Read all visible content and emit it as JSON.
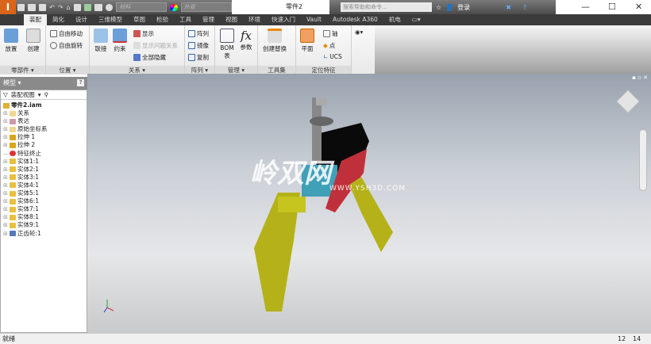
{
  "titlebar": {
    "doc_title": "零件2",
    "material_placeholder": "材料",
    "appearance_placeholder": "外观",
    "search_placeholder": "搜索帮助和命令...",
    "login": "登录"
  },
  "tabs": [
    "装配",
    "简化",
    "设计",
    "三维模型",
    "草图",
    "检验",
    "工具",
    "管理",
    "视图",
    "环境",
    "快速入门",
    "Vault",
    "Autodesk A360",
    "机电"
  ],
  "ribbon": {
    "component": {
      "place": "放置",
      "create": "创建",
      "label": "零部件 ▾"
    },
    "position": {
      "free_move": "自由移动",
      "free_rotate": "自由旋转",
      "label": "位置 ▾"
    },
    "relationships": {
      "joint": "联接",
      "constrain": "约束",
      "show": "显示",
      "show_sick": "显示问题关系",
      "hide_all": "全部隐藏",
      "label": "关系 ▾"
    },
    "pattern": {
      "pattern": "阵列",
      "mirror": "镜像",
      "copy": "复制",
      "label": "阵列 ▾"
    },
    "manage": {
      "bom": "BOM表",
      "parameters": "参数",
      "label": "管理 ▾"
    },
    "productivity": {
      "substitute": "创建替换",
      "label": "工具集"
    },
    "work_features": {
      "plane": "平面",
      "axis": "轴",
      "point": "点",
      "ucs": "UCS",
      "label": "定位特征"
    }
  },
  "model_panel": {
    "title": "模型 ▾",
    "view": "装配视图",
    "root": "零件2.iam",
    "items": [
      {
        "label": "关系",
        "icon": "folder"
      },
      {
        "label": "表达",
        "icon": "representation"
      },
      {
        "label": "原始坐标系",
        "icon": "folder"
      },
      {
        "label": "拉伸 1",
        "icon": "extrude"
      },
      {
        "label": "拉伸 2",
        "icon": "extrude"
      },
      {
        "label": "特征终止",
        "icon": "end-of-part"
      },
      {
        "label": "实体1:1",
        "icon": "part"
      },
      {
        "label": "实体2:1",
        "icon": "part"
      },
      {
        "label": "实体3:1",
        "icon": "part"
      },
      {
        "label": "实体4:1",
        "icon": "part"
      },
      {
        "label": "实体5:1",
        "icon": "part"
      },
      {
        "label": "实体6:1",
        "icon": "part"
      },
      {
        "label": "实体7:1",
        "icon": "part"
      },
      {
        "label": "实体8:1",
        "icon": "part"
      },
      {
        "label": "实体9:1",
        "icon": "part"
      },
      {
        "label": "正齿轮:1",
        "icon": "spur-gear"
      }
    ]
  },
  "watermark": {
    "brand": "岭双网",
    "url": "WWW.YSH3D.COM"
  },
  "status": {
    "text": "就绪",
    "count1": "12",
    "count2": "14"
  }
}
